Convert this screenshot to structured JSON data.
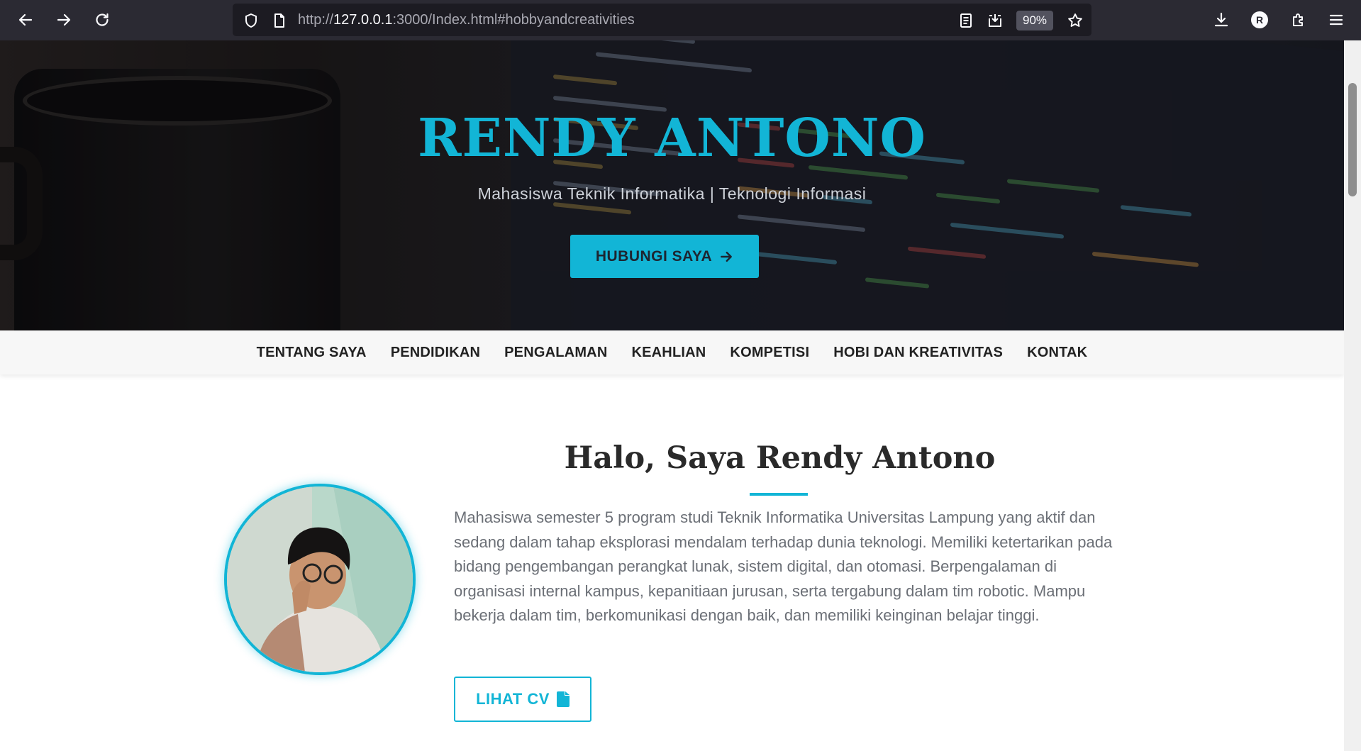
{
  "browser": {
    "url_prefix": "http://",
    "url_host": "127.0.0.1",
    "url_rest": ":3000/Index.html#hobbyandcreativities",
    "zoom": "90%",
    "profile_initial": "R"
  },
  "hero": {
    "title": "RENDY ANTONO",
    "subtitle": "Mahasiswa Teknik Informatika | Teknologi Informasi",
    "cta_label": "HUBUNGI SAYA"
  },
  "nav": {
    "items": [
      "TENTANG SAYA",
      "PENDIDIKAN",
      "PENGALAMAN",
      "KEAHLIAN",
      "KOMPETISI",
      "HOBI DAN KREATIVITAS",
      "KONTAK"
    ]
  },
  "about": {
    "title": "Halo, Saya Rendy Antono",
    "description": "Mahasiswa semester 5 program studi Teknik Informatika Universitas Lampung yang aktif dan sedang dalam tahap eksplorasi mendalam terhadap dunia teknologi. Memiliki ketertarikan pada bidang pengembangan perangkat lunak, sistem digital, dan otomasi. Berpengalaman di organisasi internal kampus, kepanitiaan jurusan, serta tergabung dalam tim robotic. Mampu bekerja dalam tim, berkomunikasi dengan baik, dan memiliki keinginan belajar tinggi.",
    "cv_label": "LIHAT CV"
  },
  "colors": {
    "accent": "#12b5d6",
    "toolbar": "#2b2a33",
    "text_muted": "#6b6f76"
  },
  "icons": {
    "back": "arrow-left-icon",
    "forward": "arrow-right-icon",
    "reload": "reload-icon",
    "tracking": "shield-icon",
    "page": "page-icon",
    "reader": "reader-view-icon",
    "save": "save-page-icon",
    "bookmark": "star-icon",
    "downloads": "download-icon",
    "extensions": "puzzle-icon",
    "menu": "hamburger-menu-icon",
    "cta": "arrow-right-icon",
    "cv": "file-icon"
  }
}
